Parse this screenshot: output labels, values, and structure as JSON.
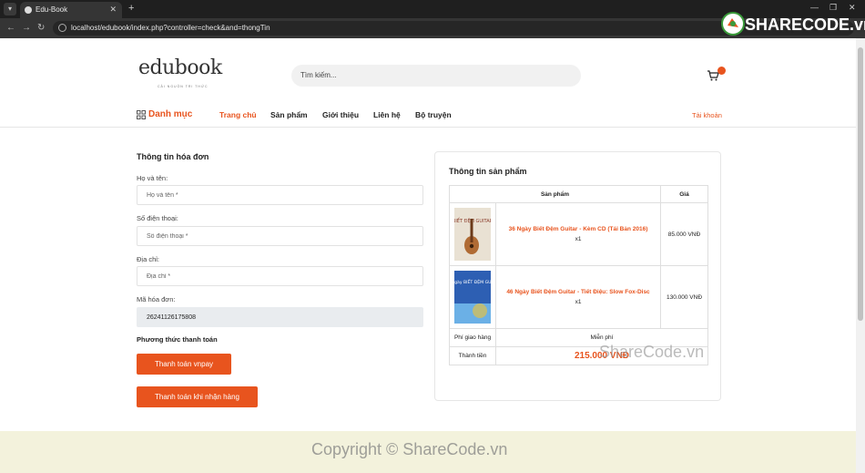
{
  "browser": {
    "tab_title": "Edu-Book",
    "url": "localhost/edubook/index.php?controller=check&and=thongTin"
  },
  "header": {
    "logo": "edubook",
    "logo_tagline": "CẢI NGUỒN TRI THỨC",
    "search_placeholder": "Tìm kiếm..."
  },
  "nav": {
    "category_label": "Danh mục",
    "items": [
      "Trang chủ",
      "Sản phẩm",
      "Giới thiệu",
      "Liên hệ",
      "Bộ truyện"
    ],
    "account_label": "Tài khoản"
  },
  "invoice_form": {
    "title": "Thông tin hóa đơn",
    "name_label": "Họ và tên:",
    "name_placeholder": "Họ và tên *",
    "phone_label": "Số điện thoại:",
    "phone_placeholder": "Số điện thoại *",
    "address_label": "Địa chỉ:",
    "address_placeholder": "Địa chỉ *",
    "invoice_code_label": "Mã hóa đơn:",
    "invoice_code_value": "26241126175808",
    "payment_method_title": "Phương thức thanh toán",
    "vnpay_button": "Thanh toán vnpay",
    "cod_button": "Thanh toán khi nhận hàng"
  },
  "product_info": {
    "title": "Thông tin sản phẩm",
    "col_product": "Sản phẩm",
    "col_price": "Giá",
    "items": [
      {
        "name": "36 Ngày Biết Đệm Guitar - Kèm CD (Tái Bản 2016)",
        "qty": "x1",
        "price": "85.000 VNĐ",
        "cover_color": "#e9e1d3",
        "cover_text": "BIẾT ĐỆM GUITAR"
      },
      {
        "name": "46 Ngày Biết Đệm Guitar - Tiết Điệu: Slow Fox-Disc",
        "qty": "x1",
        "price": "130.000 VNĐ",
        "cover_color": "#2d5fb3",
        "cover_text": "46 Ngày BIẾT ĐỆM GUITAR"
      }
    ],
    "shipping_label": "Phí giao hàng",
    "shipping_value": "Miễn phí",
    "total_label": "Thành tiền",
    "total_value": "215.000 VNĐ"
  },
  "watermarks": {
    "top": "SHARECODE.vn",
    "middle": "ShareCode.vn",
    "bottom": "Copyright © ShareCode.vn"
  },
  "colors": {
    "accent": "#e8541e",
    "footer_bg": "#f3f2dc"
  }
}
